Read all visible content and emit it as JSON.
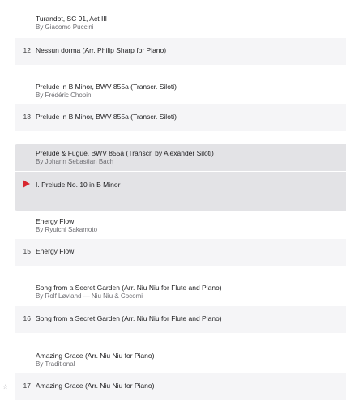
{
  "groups": [
    {
      "work_title": "Turandot, SC 91, Act III",
      "work_artist": "By Giacomo Puccini",
      "track_number": "12",
      "track_title": "Nessun dorma (Arr. Philip Sharp for Piano)"
    },
    {
      "work_title": "Prelude in B Minor, BWV 855a (Transcr. Siloti)",
      "work_artist": "By Frédéric Chopin",
      "track_number": "13",
      "track_title": "Prelude in B Minor, BWV 855a (Transcr. Siloti)"
    },
    {
      "work_title": "Prelude & Fugue, BWV 855a (Transcr. by Alexander Siloti)",
      "work_artist": "By Johann Sebastian Bach",
      "track_title": "I. Prelude No. 10 in B Minor"
    },
    {
      "work_title": "Energy Flow",
      "work_artist": "By Ryuichi Sakamoto",
      "track_number": "15",
      "track_title": "Energy Flow"
    },
    {
      "work_title": "Song from a Secret Garden (Arr. Niu Niu for Flute and Piano)",
      "work_artist": "By Rolf Løvland — Niu Niu & Cocomi",
      "track_number": "16",
      "track_title": "Song from a Secret Garden (Arr. Niu Niu for Flute and Piano)"
    },
    {
      "work_title": "Amazing Grace (Arr. Niu Niu for Piano)",
      "work_artist": "By Traditional",
      "track_number": "17",
      "track_title": "Amazing Grace (Arr. Niu Niu for Piano)"
    }
  ],
  "icons": {
    "play": "play-icon",
    "star": "star-icon"
  },
  "colors": {
    "accent": "#d8262f",
    "row_background": "#f5f5f7",
    "selected_background": "#e3e3e6"
  }
}
